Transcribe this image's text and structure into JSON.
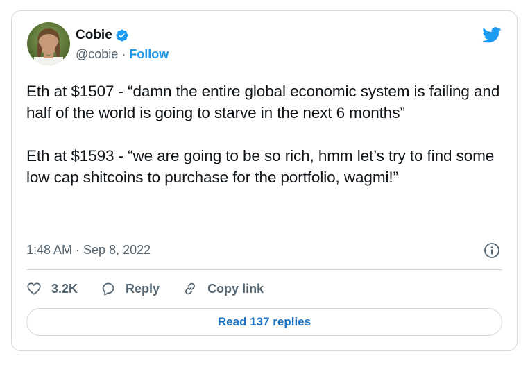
{
  "author": {
    "name": "Cobie",
    "handle": "@cobie",
    "separator": " · ",
    "follow_label": "Follow"
  },
  "tweet": {
    "text": "Eth at $1507 - “damn the entire global economic system is failing and half of the world is going to starve in the next 6 months”\n\nEth at $1593 - “we are going to be so rich, hmm let’s try to find some low cap shitcoins to purchase for the portfolio, wagmi!”",
    "timestamp": "1:48 AM · Sep 8, 2022"
  },
  "actions": {
    "like_count": "3.2K",
    "reply_label": "Reply",
    "copy_link_label": "Copy link"
  },
  "read_replies_label": "Read 137 replies",
  "icons": {
    "bird": "twitter-bird-icon",
    "verified": "verified-badge-icon",
    "info": "info-icon",
    "like": "heart-icon",
    "reply": "reply-bubble-icon",
    "link": "link-icon"
  },
  "colors": {
    "accent": "#1d9bf0",
    "secondary_text": "#536471",
    "border": "#cfd9de"
  }
}
